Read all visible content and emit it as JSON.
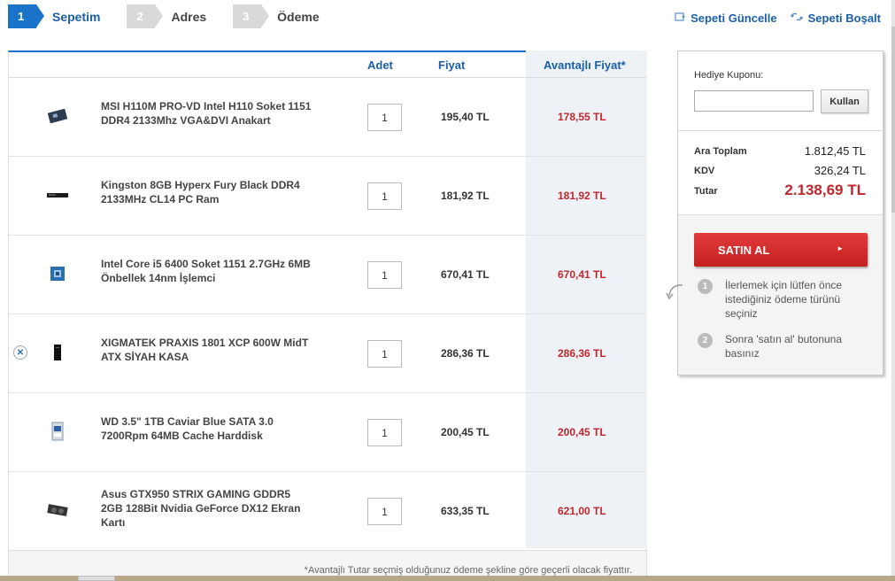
{
  "steps": [
    {
      "num": "1",
      "label": "Sepetim"
    },
    {
      "num": "2",
      "label": "Adres"
    },
    {
      "num": "3",
      "label": "Ödeme"
    }
  ],
  "actions": {
    "update": "Sepeti Güncelle",
    "empty": "Sepeti Boşalt"
  },
  "table": {
    "col_qty": "Adet",
    "col_price": "Fiyat",
    "col_adv": "Avantajlı Fiyat*"
  },
  "items": [
    {
      "name": "MSI H110M PRO-VD Intel H110 Soket 1151 DDR4 2133Mhz VGA&DVI Anakart",
      "qty": "1",
      "price": "195,40 TL",
      "adv_price": "178,55 TL",
      "icon": "motherboard-icon"
    },
    {
      "name": "Kingston 8GB Hyperx Fury Black DDR4 2133MHz CL14 PC Ram",
      "qty": "1",
      "price": "181,92 TL",
      "adv_price": "181,92 TL",
      "icon": "ram-icon"
    },
    {
      "name": "Intel Core i5 6400 Soket 1151 2.7GHz 6MB Önbellek 14nm İşlemci",
      "qty": "1",
      "price": "670,41 TL",
      "adv_price": "670,41 TL",
      "icon": "cpu-icon"
    },
    {
      "name": "XIGMATEK PRAXIS 1801 XCP 600W MidT ATX SİYAH KASA",
      "qty": "1",
      "price": "286,36 TL",
      "adv_price": "286,36 TL",
      "icon": "case-icon"
    },
    {
      "name": "WD 3.5\" 1TB Caviar Blue SATA 3.0 7200Rpm 64MB Cache Harddisk",
      "qty": "1",
      "price": "200,45 TL",
      "adv_price": "200,45 TL",
      "icon": "harddisk-icon"
    },
    {
      "name": "Asus GTX950 STRIX GAMING GDDR5 2GB 128Bit Nvidia GeForce DX12 Ekran Kartı",
      "qty": "1",
      "price": "633,35 TL",
      "adv_price": "621,00 TL",
      "icon": "graphics-card-icon"
    }
  ],
  "footnote": "*Avantajlı Tutar seçmiş olduğunuz ödeme şekline göre geçerli olacak fiyattır.",
  "summary": {
    "coupon_label": "Hediye Kuponu:",
    "coupon_value": "",
    "coupon_button": "Kullan",
    "subtotal_label": "Ara Toplam",
    "subtotal": "1.812,45 TL",
    "tax_label": "KDV",
    "tax": "326,24 TL",
    "total_label": "Tutar",
    "total": "2.138,69 TL",
    "buy_button": "SATIN AL",
    "hints": [
      {
        "num": "1",
        "text": "İlerlemek için lütfen önce istediğiniz ödeme türünü seçiniz"
      },
      {
        "num": "2",
        "text": "Sonra 'satın al' butonuna basınız"
      }
    ]
  },
  "colors": {
    "accent": "#1a73c8",
    "price_red": "#c0272d"
  }
}
